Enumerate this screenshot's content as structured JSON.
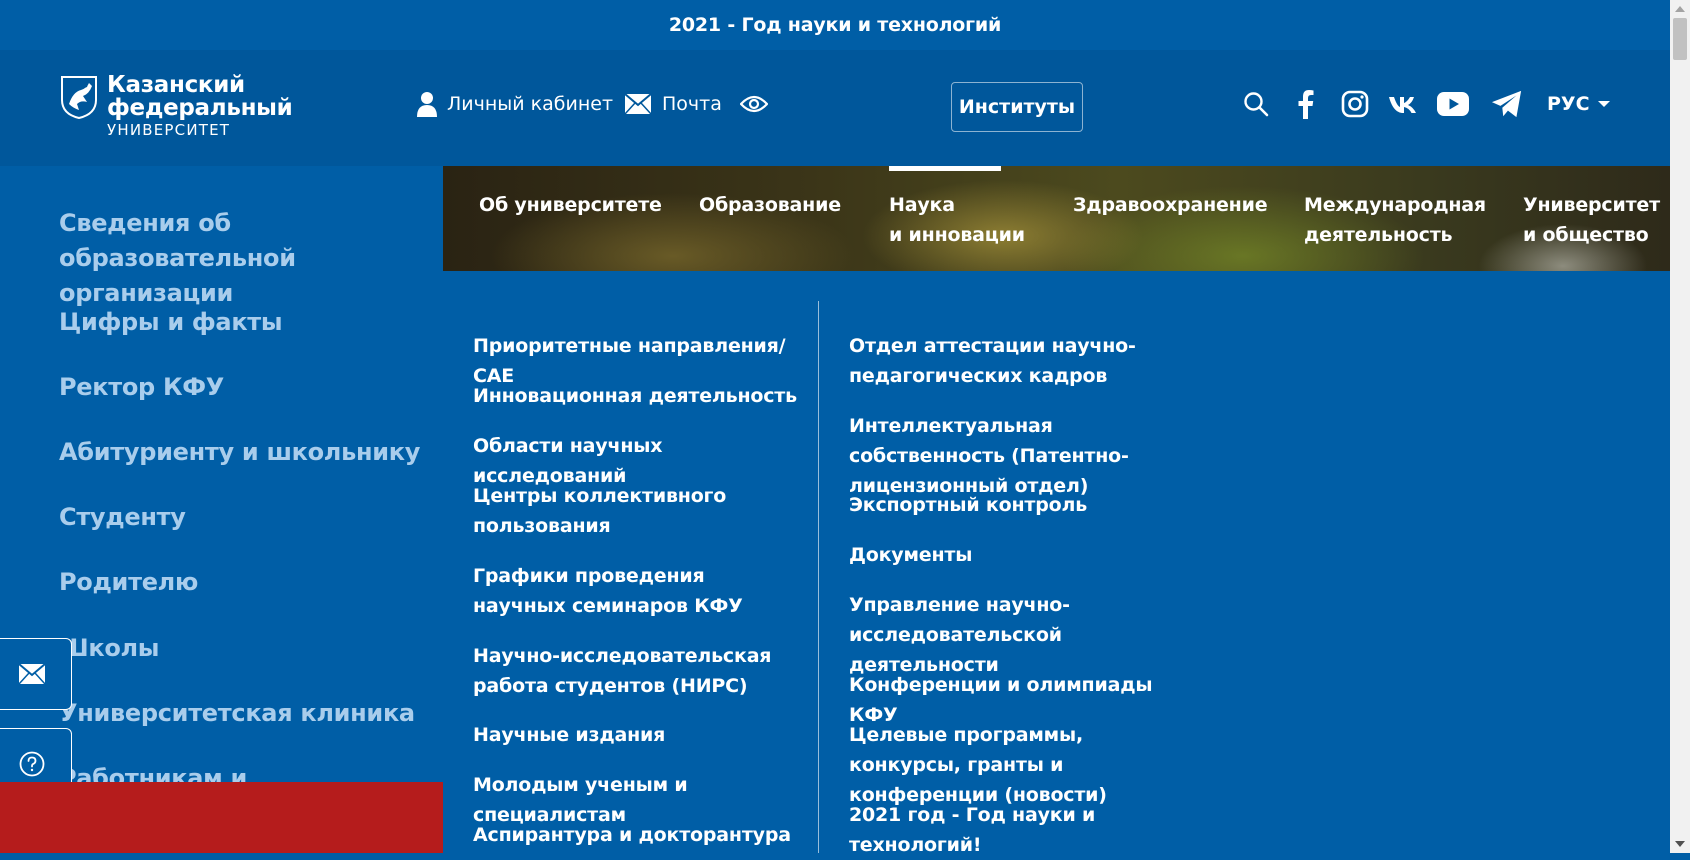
{
  "banner": {
    "text": "2021 - Год науки и технологий"
  },
  "logo": {
    "line1": "Казанский",
    "line2": "федеральный",
    "line3": "УНИВЕРСИТЕТ"
  },
  "header": {
    "cabinet_label": "Личный кабинет",
    "mail_label": "Почта",
    "institutes_label": "Институты",
    "language": "РУС",
    "icons": [
      "person-icon",
      "envelope-icon",
      "eye-icon",
      "search-icon",
      "facebook-icon",
      "instagram-icon",
      "vk-icon",
      "youtube-icon",
      "telegram-icon"
    ]
  },
  "sidebar": {
    "items": [
      "Сведения об образовательной организации",
      "Цифры и факты",
      "Ректор КФУ",
      "Абитуриенту и школьнику",
      "Студенту",
      "Родителю",
      "Школы",
      "Университетская клиника",
      "Работникам и работодателям"
    ]
  },
  "nav": {
    "items": [
      {
        "line1": "Об университете",
        "line2": ""
      },
      {
        "line1": "Образование",
        "line2": ""
      },
      {
        "line1": "Наука",
        "line2": "и инновации"
      },
      {
        "line1": "Здравоохранение",
        "line2": ""
      },
      {
        "line1": "Международная",
        "line2": "деятельность"
      },
      {
        "line1": "Университет",
        "line2": "и общество"
      }
    ],
    "active_index": 2
  },
  "mega": {
    "col1": [
      "Приоритетные направления/САЕ",
      "Инновационная деятельность",
      "Области научных исследований",
      "Центры коллективного пользования",
      "Графики проведения научных семинаров КФУ",
      "Научно-исследовательская работа студентов (НИРС)",
      "Научные издания",
      "Молодым ученым и специалистам",
      "Аспирантура и докторантура"
    ],
    "col2": [
      "Отдел аттестации научно-педагогических кадров",
      "Интеллектуальная собственность (Патентно-лицензионный отдел)",
      "Экспортный контроль",
      "Документы",
      "Управление научно-исследовательской деятельности",
      "Конференции и олимпиады КФУ",
      "Целевые программы, конкурсы, гранты и конференции (новости)",
      "2021 год - Год науки и технологий!"
    ]
  },
  "colors": {
    "page_blue": "#005ea6",
    "header_blue": "#00579b",
    "sidebar_text": "#a9cdec",
    "red_block": "#b51c1c"
  }
}
